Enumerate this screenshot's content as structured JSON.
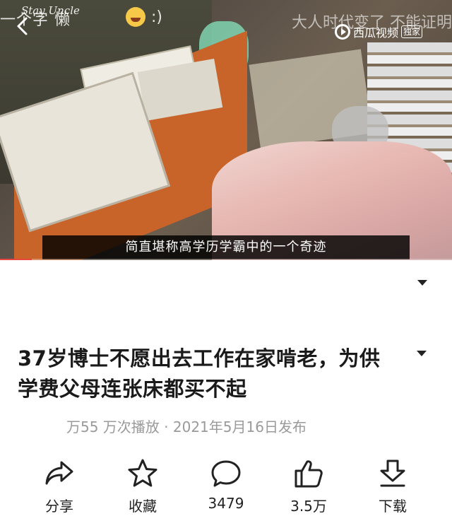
{
  "video": {
    "overlay_left_text": "一个字 懒",
    "overlay_signature": "Stay Uncle",
    "overlay_emoji_tail": ":)",
    "overlay_right_text": "大人时代变了 不能证明",
    "watermark_brand": "西瓜视频",
    "watermark_badge": "独家",
    "subtitle": "简直堪称高学历学霸中的一个奇迹",
    "progress": 0.07,
    "icons": {
      "back": "back-arrow-icon",
      "emoji": "laughing-emoji-icon",
      "watermark": "xigua-logo-icon"
    }
  },
  "title": "37岁博士不愿出去工作在家啃老，为供学费父母连张床都买不起",
  "meta": {
    "text": "万55 万次播放 · 2021年5月16日发布"
  },
  "actions": [
    {
      "label": "分享",
      "icon": "share-icon"
    },
    {
      "label": "收藏",
      "icon": "star-icon"
    },
    {
      "label": "3479",
      "icon": "comment-icon"
    },
    {
      "label": "3.5万",
      "icon": "thumbs-up-icon"
    },
    {
      "label": "下载",
      "icon": "download-icon"
    }
  ],
  "colors": {
    "accent": "#e8473f",
    "meta_gray": "#9a9a9a",
    "title": "#1a1a1a"
  }
}
